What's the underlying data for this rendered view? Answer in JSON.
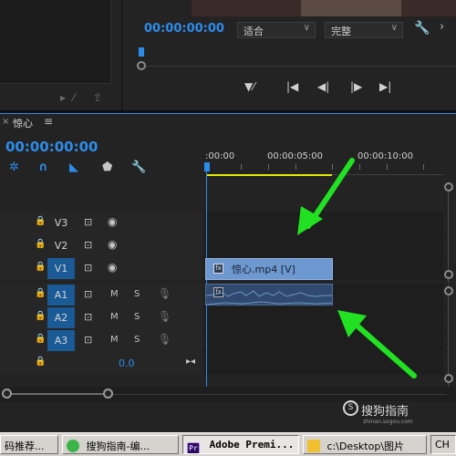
{
  "program_monitor": {
    "timecode": "00:00:00:00",
    "zoom_select": "适合",
    "quality_select": "完整",
    "icons": [
      "export-frame-icon",
      "step-back-icon",
      "play-back-icon",
      "play-icon",
      "step-forward-icon",
      "wrench-icon",
      "chevron-right-icon"
    ]
  },
  "timeline": {
    "sequence_name": "惊心",
    "close_glyph": "×",
    "menu_glyph": "≡",
    "timecode": "00:00:00:00",
    "ruler_labels": [
      ":00:00",
      "00:00:05:00",
      "00:00:10:00"
    ],
    "tracks": [
      {
        "id": "V3",
        "kind": "video",
        "targeted": false
      },
      {
        "id": "V2",
        "kind": "video",
        "targeted": false
      },
      {
        "id": "V1",
        "kind": "video",
        "targeted": true
      },
      {
        "id": "A1",
        "kind": "audio",
        "targeted": true
      },
      {
        "id": "A2",
        "kind": "audio",
        "targeted": true
      },
      {
        "id": "A3",
        "kind": "audio",
        "targeted": true
      }
    ],
    "master_value": "0.0",
    "mute_label": "M",
    "solo_label": "S",
    "video_clip_label": "惊心.mp4 [V]",
    "fx_badge": "fx"
  },
  "watermark": {
    "text": "搜狗指南",
    "logo": "S",
    "url": "zhinan.sogou.com"
  },
  "taskbar": {
    "items": [
      {
        "label": "码推荐...",
        "icon_color": "#d6d3ce",
        "active": false
      },
      {
        "label": "搜狗指南-编...",
        "icon_color": "#3bb44a",
        "active": false
      },
      {
        "label": "Adobe Premi...",
        "icon_color": "#2a0a5a",
        "active": true
      },
      {
        "label": "c:\\Desktop\\图片",
        "icon_color": "#f0c030",
        "active": false
      }
    ],
    "tray": "CH"
  },
  "colors": {
    "accent": "#2d8ceb",
    "video_clip": "#6e98d0",
    "audio_clip": "#2f4a6e",
    "annotation_arrow": "#22e022",
    "work_area": "#e8e800"
  }
}
